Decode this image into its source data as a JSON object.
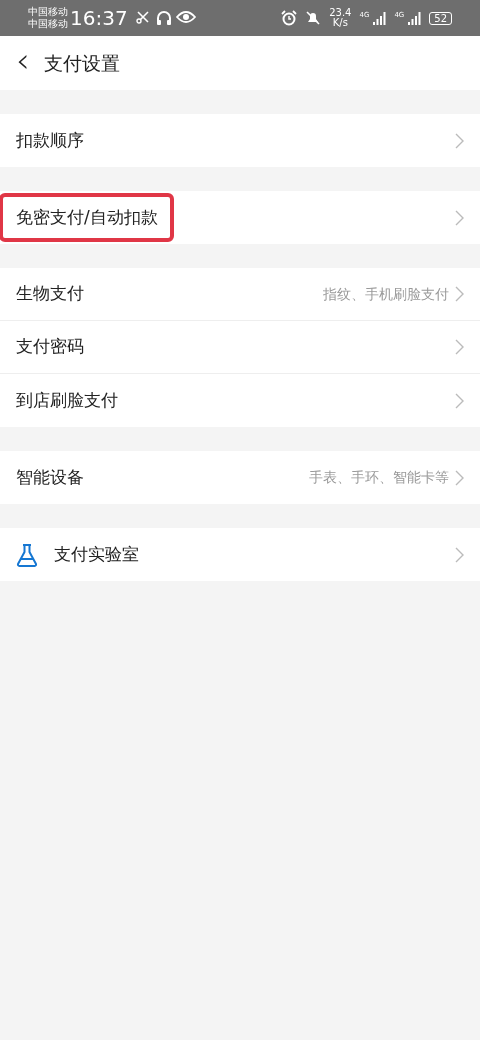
{
  "status_bar": {
    "carriers": [
      "中国移动",
      "中国移动"
    ],
    "time": "16:37",
    "speed_value": "23.4",
    "speed_unit": "K/s",
    "networks": [
      "4G",
      "4G"
    ],
    "battery": "52"
  },
  "header": {
    "back": "‹",
    "title": "支付设置"
  },
  "groups": [
    {
      "items": [
        {
          "kind": "plain",
          "label": "扣款顺序",
          "highlighted": false
        }
      ]
    },
    {
      "items": [
        {
          "kind": "plain",
          "label": "免密支付/自动扣款",
          "highlighted": true
        }
      ]
    },
    {
      "items": [
        {
          "kind": "plain",
          "label": "生物支付",
          "value": "指纹、手机刷脸支付",
          "highlighted": false
        },
        {
          "kind": "plain",
          "label": "支付密码",
          "highlighted": false
        },
        {
          "kind": "plain",
          "label": "到店刷脸支付",
          "highlighted": false
        }
      ]
    },
    {
      "items": [
        {
          "kind": "plain",
          "label": "智能设备",
          "value": "手表、手环、智能卡等",
          "highlighted": false
        }
      ]
    },
    {
      "items": [
        {
          "kind": "icon",
          "label": "支付实验室",
          "highlighted": false
        }
      ]
    }
  ]
}
